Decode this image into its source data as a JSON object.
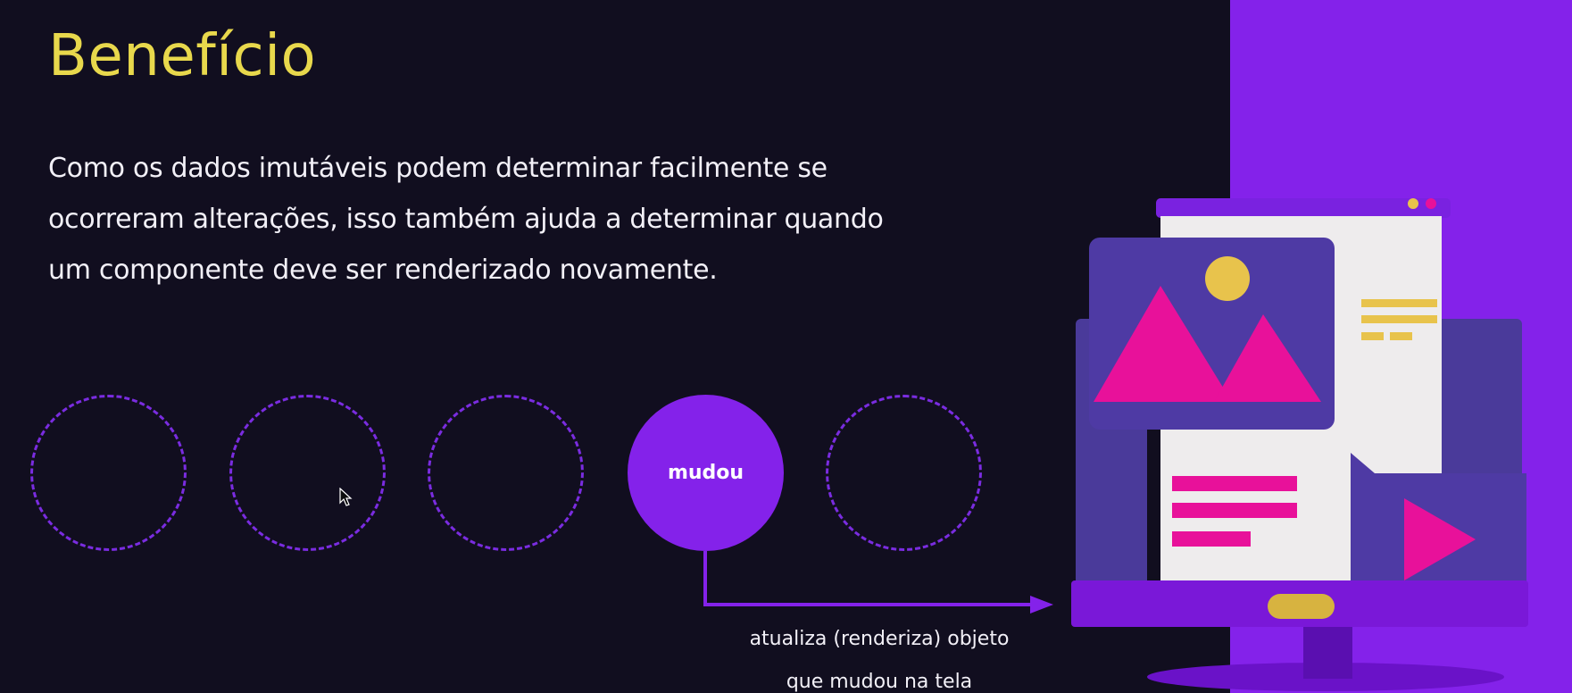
{
  "slide": {
    "title": "Benefício",
    "body_lines": [
      "Como os dados imutáveis podem determinar facilmente se",
      "ocorreram alterações, isso também ajuda a determinar quando",
      "um componente deve ser renderizado novamente."
    ],
    "circles": [
      {
        "state": "unchanged",
        "label": ""
      },
      {
        "state": "unchanged",
        "label": ""
      },
      {
        "state": "unchanged",
        "label": ""
      },
      {
        "state": "changed",
        "label": "mudou"
      },
      {
        "state": "unchanged",
        "label": ""
      }
    ],
    "caption_lines": [
      "atualiza (renderiza) objeto",
      "que mudou na tela"
    ]
  },
  "colors": {
    "background": "#110e1f",
    "accent_purple": "#8422ea",
    "title_yellow": "#e8d84c",
    "text_white": "#f2f0f7",
    "illustration_pink": "#e8119a"
  },
  "icons": {
    "cursor": "mouse-pointer-icon",
    "illustration": "monitor-media-illustration"
  }
}
